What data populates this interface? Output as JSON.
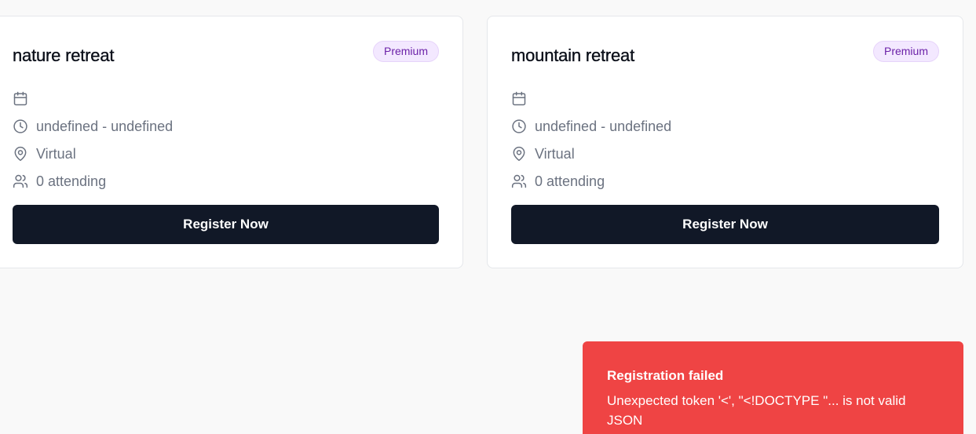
{
  "events": [
    {
      "title": "nature retreat",
      "badge": "Premium",
      "date": "",
      "time": "undefined - undefined",
      "location": "Virtual",
      "attending": "0 attending",
      "button_label": "Register Now"
    },
    {
      "title": "mountain retreat",
      "badge": "Premium",
      "date": "",
      "time": "undefined - undefined",
      "location": "Virtual",
      "attending": "0 attending",
      "button_label": "Register Now"
    }
  ],
  "toast": {
    "title": "Registration failed",
    "description": "Unexpected token '<', \"<!DOCTYPE \"... is not valid JSON"
  },
  "icons": {
    "date": "calendar-icon",
    "time": "clock-icon",
    "location": "map-pin-icon",
    "attending": "users-icon"
  },
  "colors": {
    "button": "#111827",
    "badge_bg": "#f3e8ff",
    "badge_text": "#6b21a8",
    "toast_bg": "#ef4444"
  }
}
